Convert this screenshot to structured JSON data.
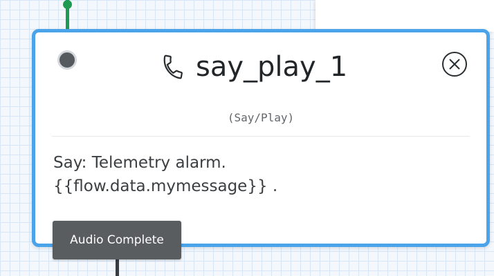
{
  "widget": {
    "title": "say_play_1",
    "type_label": "(Say/Play)",
    "body_line1": "Say: Telemetry alarm.",
    "body_line2": "{{flow.data.mymessage}} .",
    "icon": "phone-icon",
    "close_icon": "close-circle-icon"
  },
  "transition": {
    "label": "Audio Complete"
  },
  "colors": {
    "selected_border": "#4ba3ea",
    "incoming_connector": "#1f9a52",
    "outgoing_connector": "#3a3d40",
    "transition_label_bg": "#5a5d60",
    "canvas_grid": "#d6e6f6"
  }
}
